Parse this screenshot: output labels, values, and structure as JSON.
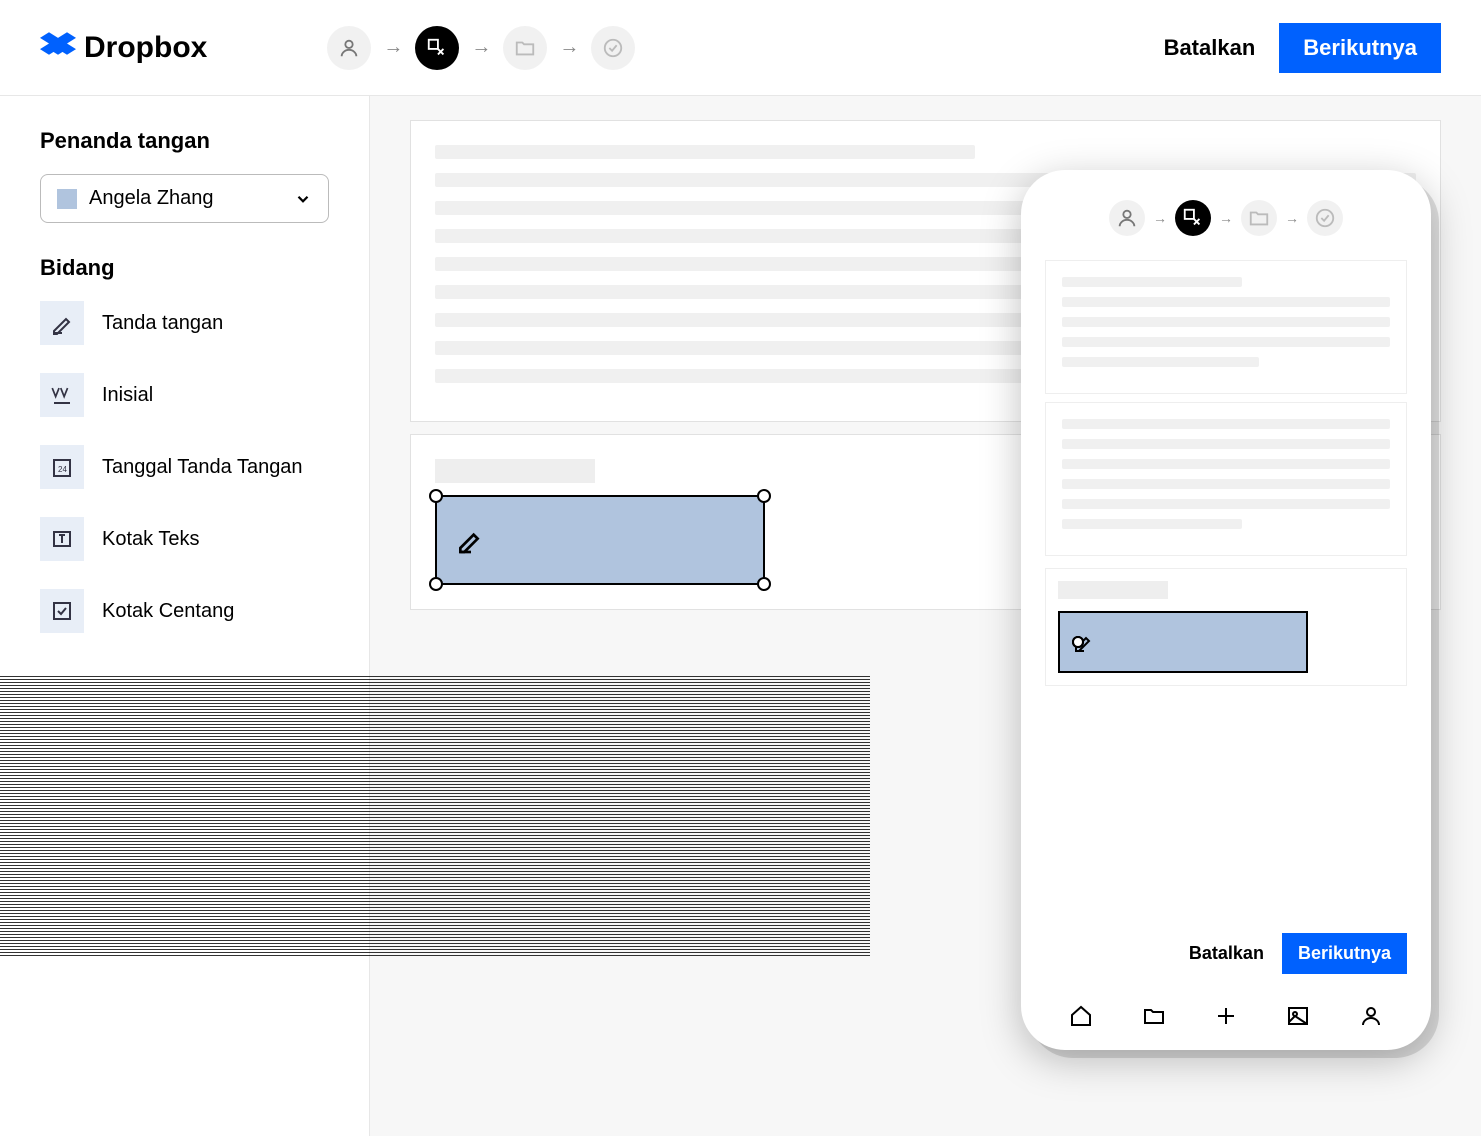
{
  "brand": "Dropbox",
  "header": {
    "cancel": "Batalkan",
    "next": "Berikutnya"
  },
  "sidebar": {
    "signers_heading": "Penanda tangan",
    "selected_signer": "Angela Zhang",
    "fields_heading": "Bidang",
    "fields": [
      {
        "label": "Tanda tangan",
        "icon": "signature-icon"
      },
      {
        "label": "Inisial",
        "icon": "initials-icon"
      },
      {
        "label": "Tanggal Tanda Tangan",
        "icon": "date-icon"
      },
      {
        "label": "Kotak Teks",
        "icon": "textbox-icon"
      },
      {
        "label": "Kotak Centang",
        "icon": "checkbox-icon"
      }
    ]
  },
  "mobile": {
    "cancel": "Batalkan",
    "next": "Berikutnya"
  },
  "colors": {
    "primary": "#0061fe",
    "signer_field": "#b0c4de",
    "field_icon_bg": "#e8eef7"
  }
}
